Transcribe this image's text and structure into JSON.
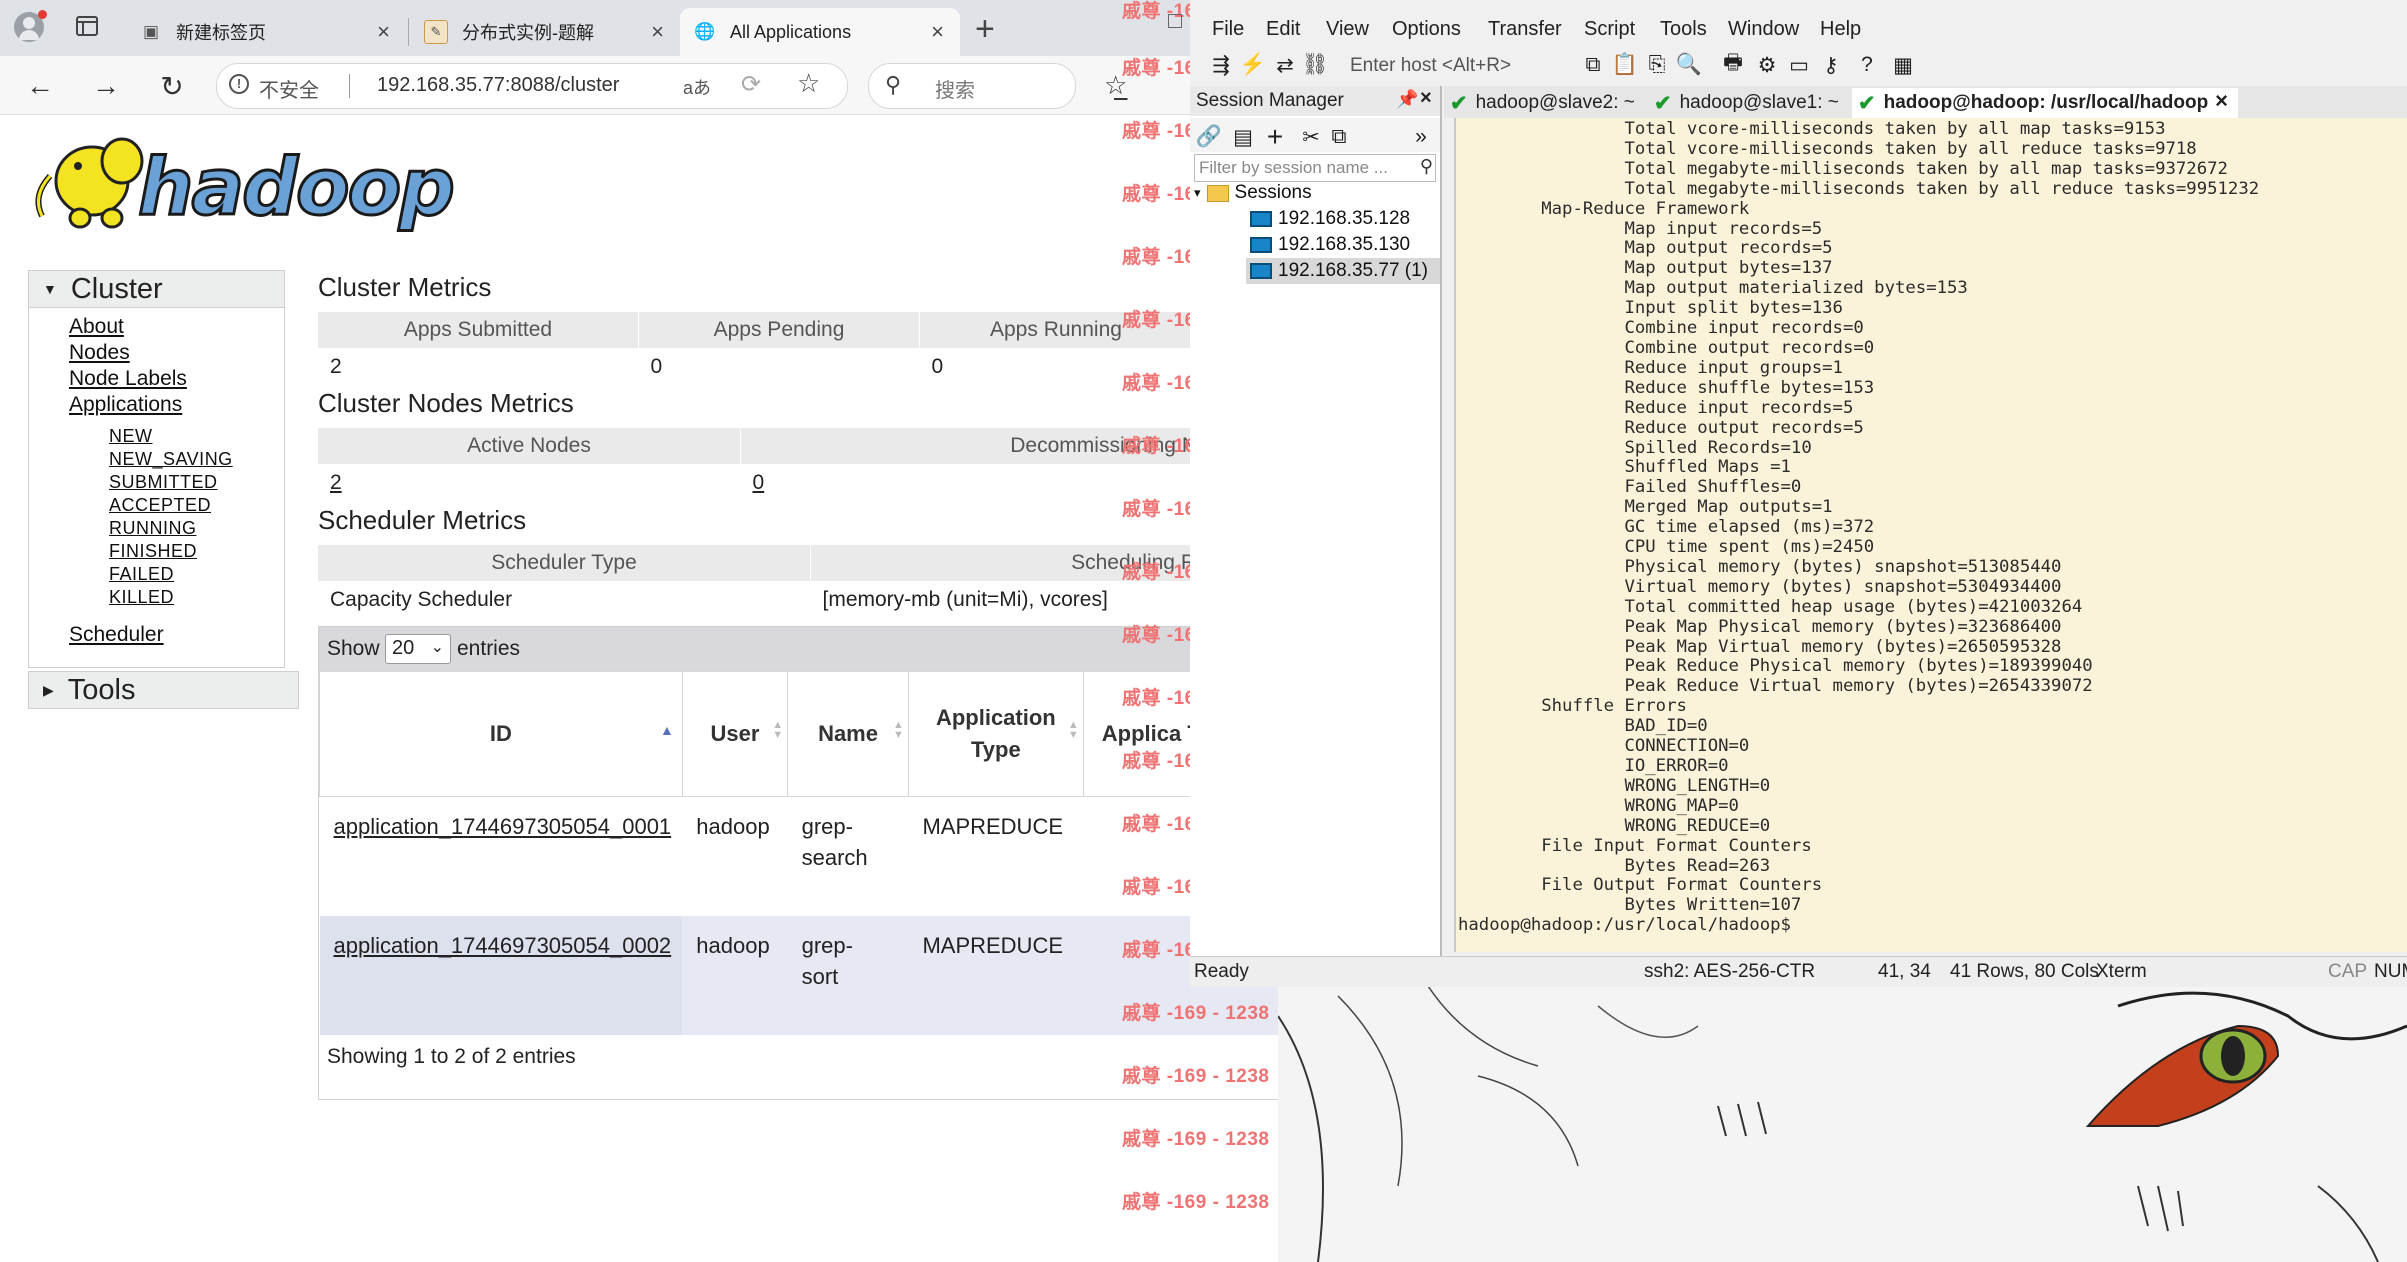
{
  "browser": {
    "tabs": [
      {
        "label": "新建标签页"
      },
      {
        "label": "分布式实例-题解"
      },
      {
        "label": "All Applications"
      }
    ],
    "security": "不安全",
    "url": "192.168.35.77:8088/cluster",
    "search_placeholder": "搜索"
  },
  "hadoop": {
    "logo_text": "hadoop",
    "nav": {
      "cluster": "Cluster",
      "about": "About",
      "nodes": "Nodes",
      "node_labels": "Node Labels",
      "applications": "Applications",
      "states": [
        "NEW",
        "NEW_SAVING",
        "SUBMITTED",
        "ACCEPTED",
        "RUNNING",
        "FINISHED",
        "FAILED",
        "KILLED"
      ],
      "scheduler": "Scheduler",
      "tools": "Tools"
    },
    "cluster_metrics": {
      "title": "Cluster Metrics",
      "headers": [
        "Apps Submitted",
        "Apps Pending",
        "Apps Running"
      ],
      "values": [
        "2",
        "0",
        "0"
      ]
    },
    "nodes_metrics": {
      "title": "Cluster Nodes Metrics",
      "headers": [
        "Active Nodes",
        "Decommissioning N"
      ],
      "values": [
        "2",
        "0"
      ]
    },
    "scheduler_metrics": {
      "title": "Scheduler Metrics",
      "headers": [
        "Scheduler Type",
        "Scheduling R"
      ],
      "values": [
        "Capacity Scheduler",
        "[memory-mb (unit=Mi), vcores]"
      ]
    },
    "apps_table": {
      "show": "Show",
      "entries_value": "20",
      "entries": "entries",
      "headers": [
        "ID",
        "User",
        "Name",
        "Application Type",
        "Applica Tag"
      ],
      "rows": [
        {
          "id": "application_1744697305054_0001",
          "user": "hadoop",
          "name": "grep-search",
          "type": "MAPREDUCE"
        },
        {
          "id": "application_1744697305054_0002",
          "user": "hadoop",
          "name": "grep-sort",
          "type": "MAPREDUCE"
        }
      ],
      "info": "Showing 1 to 2 of 2 entries"
    }
  },
  "watermark": {
    "text": "戚尊 -169 - 1238"
  },
  "crt": {
    "menu": [
      "File",
      "Edit",
      "View",
      "Options",
      "Transfer",
      "Script",
      "Tools",
      "Window",
      "Help"
    ],
    "enter_host": "Enter host <Alt+R>",
    "session_manager": {
      "title": "Session Manager",
      "filter_placeholder": "Filter by session name ...",
      "folder": "Sessions",
      "sessions": [
        "192.168.35.128",
        "192.168.35.130",
        "192.168.35.77 (1)"
      ]
    },
    "tabs": [
      "hadoop@slave2: ~",
      "hadoop@slave1: ~",
      "hadoop@hadoop: /usr/local/hadoop"
    ],
    "terminal_lines": [
      "                Total vcore-milliseconds taken by all map tasks=9153",
      "                Total vcore-milliseconds taken by all reduce tasks=9718",
      "                Total megabyte-milliseconds taken by all map tasks=9372672",
      "                Total megabyte-milliseconds taken by all reduce tasks=9951232",
      "        Map-Reduce Framework",
      "                Map input records=5",
      "                Map output records=5",
      "                Map output bytes=137",
      "                Map output materialized bytes=153",
      "                Input split bytes=136",
      "                Combine input records=0",
      "                Combine output records=0",
      "                Reduce input groups=1",
      "                Reduce shuffle bytes=153",
      "                Reduce input records=5",
      "                Reduce output records=5",
      "                Spilled Records=10",
      "                Shuffled Maps =1",
      "                Failed Shuffles=0",
      "                Merged Map outputs=1",
      "                GC time elapsed (ms)=372",
      "                CPU time spent (ms)=2450",
      "                Physical memory (bytes) snapshot=513085440",
      "                Virtual memory (bytes) snapshot=5304934400",
      "                Total committed heap usage (bytes)=421003264",
      "                Peak Map Physical memory (bytes)=323686400",
      "                Peak Map Virtual memory (bytes)=2650595328",
      "                Peak Reduce Physical memory (bytes)=189399040",
      "                Peak Reduce Virtual memory (bytes)=2654339072",
      "        Shuffle Errors",
      "                BAD_ID=0",
      "                CONNECTION=0",
      "                IO_ERROR=0",
      "                WRONG_LENGTH=0",
      "                WRONG_MAP=0",
      "                WRONG_REDUCE=0",
      "        File Input Format Counters",
      "                Bytes Read=263",
      "        File Output Format Counters",
      "                Bytes Written=107",
      "hadoop@hadoop:/usr/local/hadoop$"
    ],
    "status": {
      "ready": "Ready",
      "cipher": "ssh2: AES-256-CTR",
      "cursor": "41,  34",
      "size": "41 Rows, 80 Cols",
      "term": "Xterm",
      "cap": "CAP",
      "num": "NUM"
    }
  }
}
